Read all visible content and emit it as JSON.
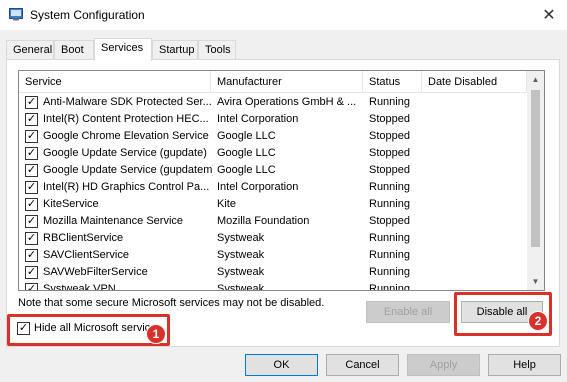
{
  "window": {
    "title": "System Configuration",
    "close_glyph": "✕",
    "icon": "msconfig-icon"
  },
  "tabs": [
    {
      "label": "General",
      "active": false
    },
    {
      "label": "Boot",
      "active": false
    },
    {
      "label": "Services",
      "active": true
    },
    {
      "label": "Startup",
      "active": false
    },
    {
      "label": "Tools",
      "active": false
    }
  ],
  "services": {
    "columns": [
      "Service",
      "Manufacturer",
      "Status",
      "Date Disabled"
    ],
    "rows": [
      {
        "name": "Anti-Malware SDK Protected Ser...",
        "manufacturer": "Avira Operations GmbH & ...",
        "status": "Running",
        "date": "",
        "checked": true
      },
      {
        "name": "Intel(R) Content Protection HEC...",
        "manufacturer": "Intel Corporation",
        "status": "Stopped",
        "date": "",
        "checked": true
      },
      {
        "name": "Google Chrome Elevation Service",
        "manufacturer": "Google LLC",
        "status": "Stopped",
        "date": "",
        "checked": true
      },
      {
        "name": "Google Update Service (gupdate)",
        "manufacturer": "Google LLC",
        "status": "Stopped",
        "date": "",
        "checked": true
      },
      {
        "name": "Google Update Service (gupdatem)",
        "manufacturer": "Google LLC",
        "status": "Stopped",
        "date": "",
        "checked": true
      },
      {
        "name": "Intel(R) HD Graphics Control Pa...",
        "manufacturer": "Intel Corporation",
        "status": "Running",
        "date": "",
        "checked": true
      },
      {
        "name": "KiteService",
        "manufacturer": "Kite",
        "status": "Running",
        "date": "",
        "checked": true
      },
      {
        "name": "Mozilla Maintenance Service",
        "manufacturer": "Mozilla Foundation",
        "status": "Stopped",
        "date": "",
        "checked": true
      },
      {
        "name": "RBClientService",
        "manufacturer": "Systweak",
        "status": "Running",
        "date": "",
        "checked": true
      },
      {
        "name": "SAVClientService",
        "manufacturer": "Systweak",
        "status": "Running",
        "date": "",
        "checked": true
      },
      {
        "name": "SAVWebFilterService",
        "manufacturer": "Systweak",
        "status": "Running",
        "date": "",
        "checked": true
      },
      {
        "name": "Systweak VPN",
        "manufacturer": "Systweak",
        "status": "Running",
        "date": "",
        "checked": true
      }
    ]
  },
  "note": "Note that some secure Microsoft services may not be disabled.",
  "enable_all": "Enable all",
  "disable_all": "Disable all",
  "hide_microsoft": {
    "label": "Hide all Microsoft services",
    "checked": true
  },
  "callouts": {
    "one": "1",
    "two": "2",
    "color": "#d9302a"
  },
  "footer": {
    "ok": "OK",
    "cancel": "Cancel",
    "apply": "Apply",
    "help": "Help"
  },
  "glyphs": {
    "check": "✓",
    "up": "▲",
    "down": "▼"
  }
}
